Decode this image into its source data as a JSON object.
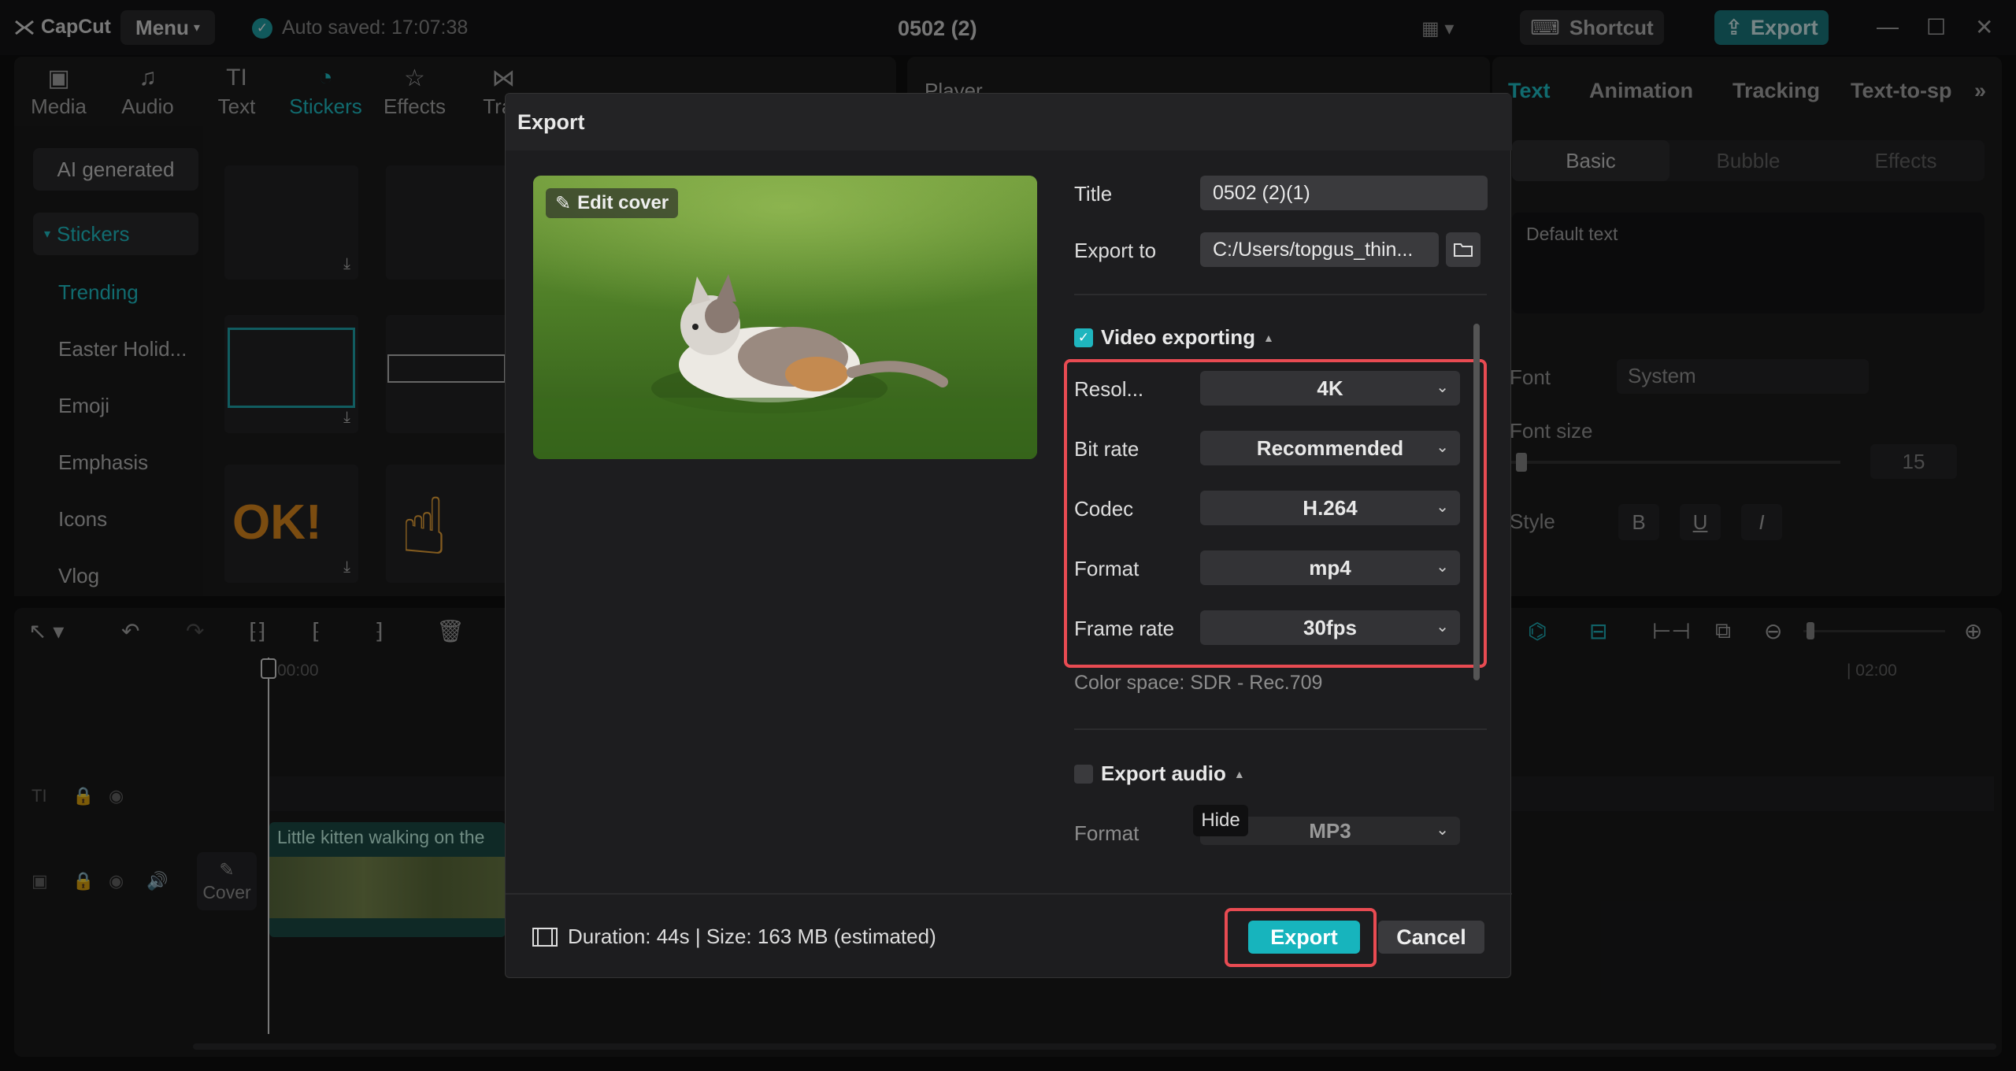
{
  "app": {
    "logo": "CapCut",
    "menu_label": "Menu",
    "autosave": "Auto saved: 17:07:38",
    "project_title": "0502 (2)",
    "shortcut_label": "Shortcut",
    "export_label": "Export"
  },
  "toolbar": {
    "tabs": [
      {
        "label": "Media",
        "icon": "media-icon"
      },
      {
        "label": "Audio",
        "icon": "audio-icon"
      },
      {
        "label": "Text",
        "icon": "text-icon"
      },
      {
        "label": "Stickers",
        "icon": "stickers-icon"
      },
      {
        "label": "Effects",
        "icon": "effects-icon"
      },
      {
        "label": "Tran",
        "icon": "transitions-icon"
      }
    ]
  },
  "sidebar": {
    "ai_generated": "AI generated",
    "stickers_header": "Stickers",
    "items": [
      "Trending",
      "Easter Holid...",
      "Emoji",
      "Emphasis",
      "Icons",
      "Vlog"
    ]
  },
  "player": {
    "label": "Player"
  },
  "inspector": {
    "tabs": [
      "Text",
      "Animation",
      "Tracking",
      "Text-to-sp"
    ],
    "segments": [
      "Basic",
      "Bubble",
      "Effects"
    ],
    "default_text": "Default text",
    "font_label": "Font",
    "font_value": "System",
    "font_size_label": "Font size",
    "font_size_value": "15",
    "style_label": "Style"
  },
  "timeline": {
    "time_start": "00:00",
    "time_mid": "| 02:00",
    "cover_label": "Cover",
    "clip_label": "Little kitten walking on the"
  },
  "export_dialog": {
    "header": "Export",
    "edit_cover": "Edit cover",
    "title_label": "Title",
    "title_value": "0502 (2)(1)",
    "export_to_label": "Export to",
    "export_to_value": "C:/Users/topgus_thin...",
    "video_section": "Video exporting",
    "video_fields": [
      {
        "label": "Resol...",
        "value": "4K"
      },
      {
        "label": "Bit rate",
        "value": "Recommended"
      },
      {
        "label": "Codec",
        "value": "H.264"
      },
      {
        "label": "Format",
        "value": "mp4"
      },
      {
        "label": "Frame rate",
        "value": "30fps"
      }
    ],
    "color_space": "Color space: SDR - Rec.709",
    "audio_section": "Export audio",
    "audio_format_label": "Format",
    "audio_format_value": "MP3",
    "tooltip": "Hide",
    "footer_info": "Duration: 44s | Size: 163 MB (estimated)",
    "export_button": "Export",
    "cancel_button": "Cancel"
  },
  "colors": {
    "accent": "#1fb5be",
    "highlight": "#e84b52"
  }
}
